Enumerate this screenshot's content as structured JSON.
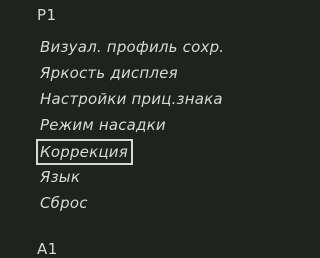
{
  "header": {
    "page_label": "P1"
  },
  "menu": {
    "items": [
      {
        "label": "Визуал. профиль сохр."
      },
      {
        "label": "Яркость дисплея"
      },
      {
        "label": "Настройки приц.знака"
      },
      {
        "label": "Режим насадки"
      },
      {
        "label": "Коррекция",
        "selected": true
      },
      {
        "label": "Язык"
      },
      {
        "label": "Сброс"
      }
    ]
  },
  "footer": {
    "page_label": "A1"
  },
  "colors": {
    "background": "#1e2320",
    "text": "#d6d9d4"
  }
}
